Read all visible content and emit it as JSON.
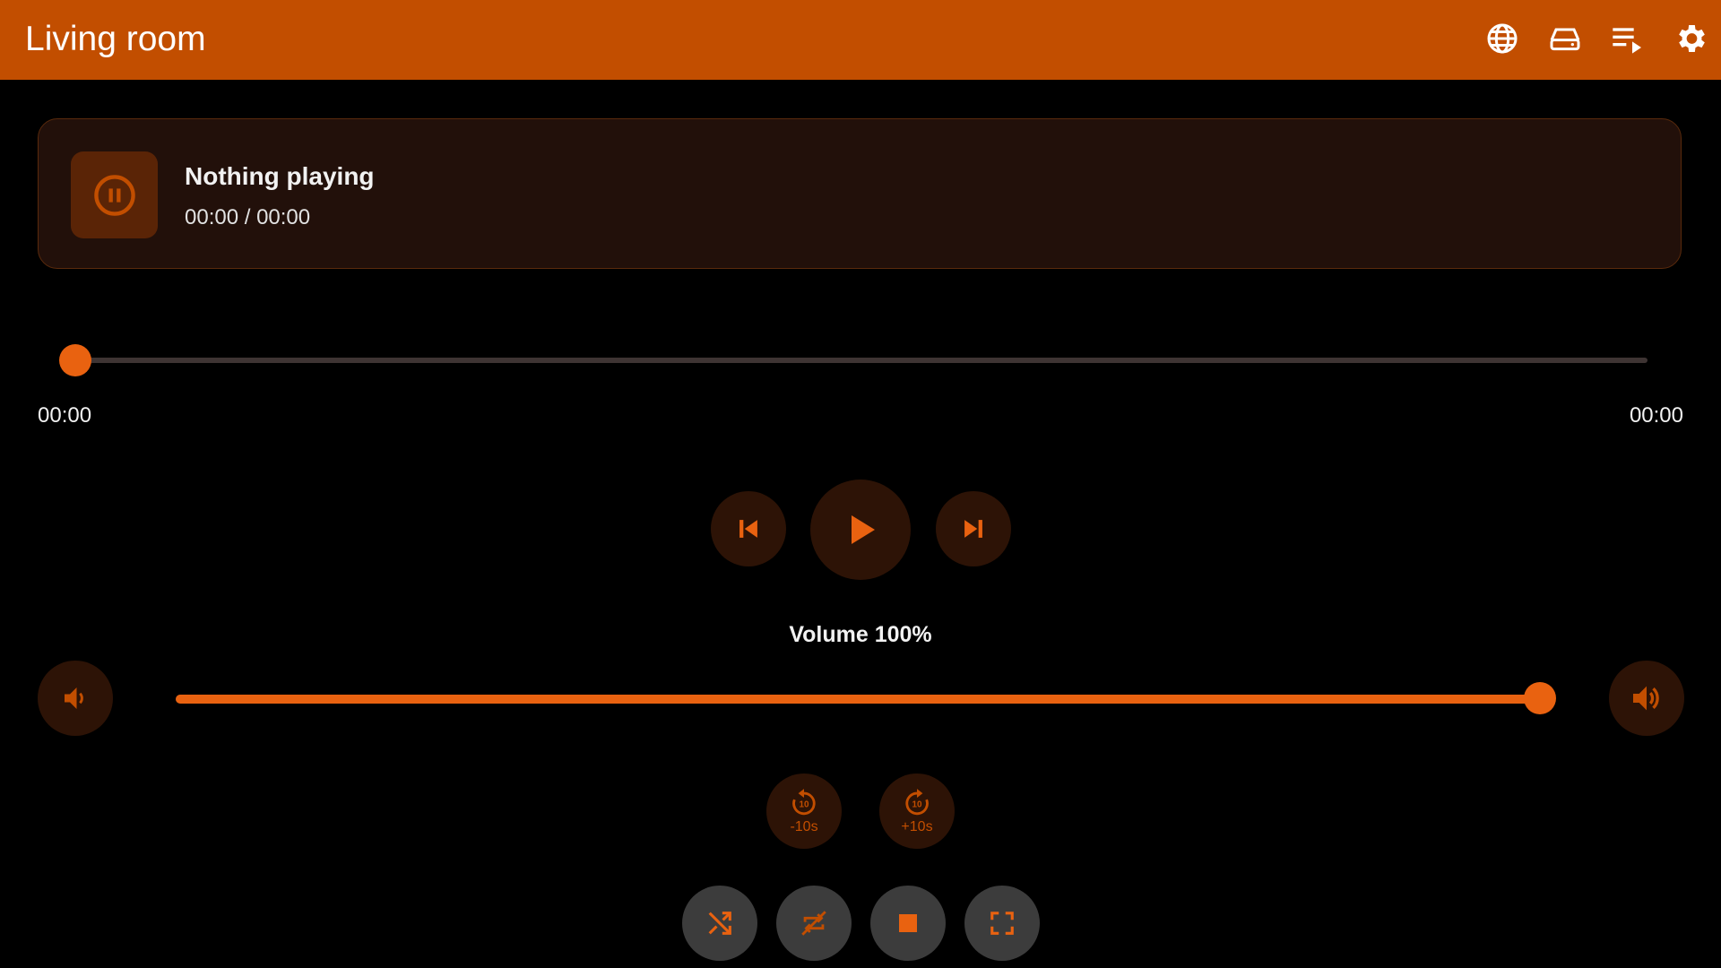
{
  "app": {
    "title": "Living room",
    "accent_color": "#c24e00",
    "header_icons": [
      "globe-icon",
      "device-icon",
      "queue-icon",
      "settings-icon"
    ]
  },
  "now_playing": {
    "status_icon": "pause-circle-icon",
    "title": "Nothing playing",
    "time": "00:00 / 00:00"
  },
  "seek": {
    "progress": 0,
    "elapsed": "00:00",
    "duration": "00:00"
  },
  "transport": {
    "previous_icon": "skip-previous-icon",
    "play_icon": "play-icon",
    "next_icon": "skip-next-icon"
  },
  "volume": {
    "label": "Volume 100%",
    "level": 1.0,
    "down_icon": "volume-down-icon",
    "up_icon": "volume-up-icon"
  },
  "skip": {
    "back_label": "-10s",
    "back_badge": "10",
    "forward_label": "+10s",
    "forward_badge": "10"
  },
  "modes": {
    "shuffle_icon": "shuffle-icon",
    "repeat_icon": "repeat-off-icon",
    "stop_icon": "stop-icon",
    "fullscreen_icon": "fullscreen-icon"
  }
}
